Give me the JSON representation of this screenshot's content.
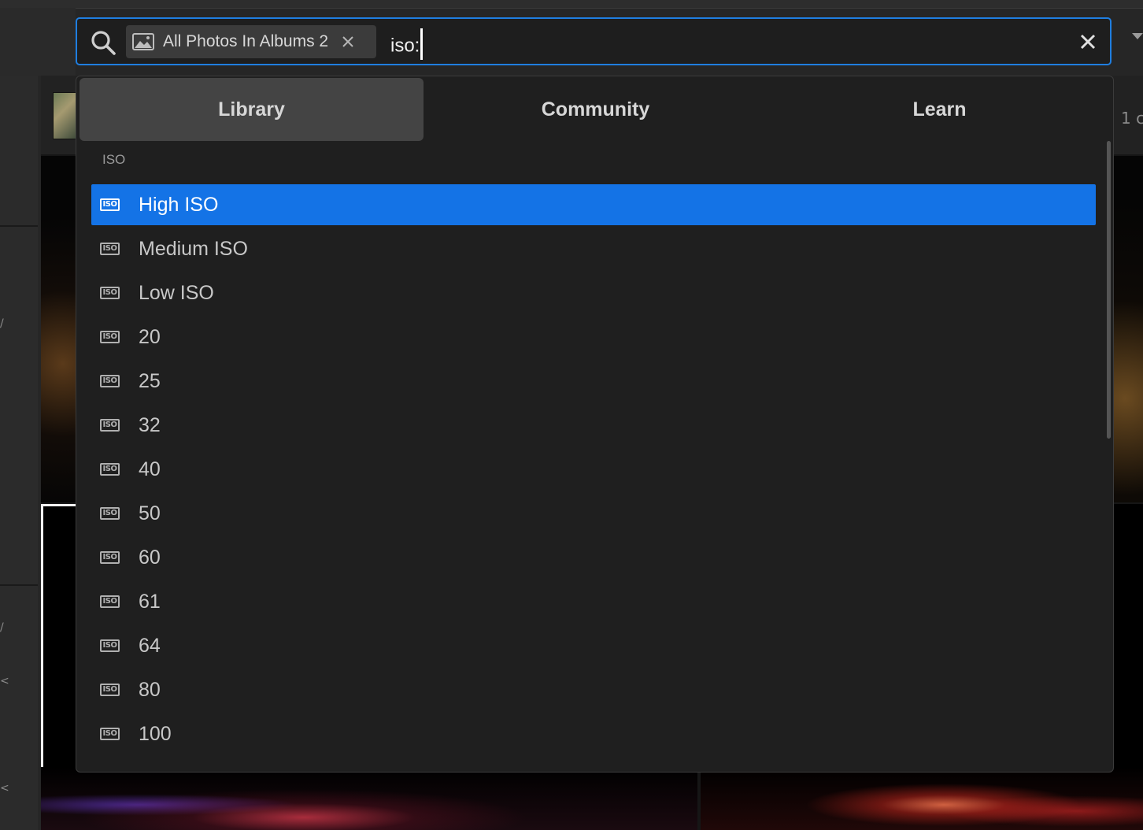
{
  "background": {
    "page_count_text": "1 c"
  },
  "search": {
    "scope_chip_label": "All Photos In Albums 2",
    "query": "iso:",
    "accent_color": "#1f7ee0"
  },
  "dropdown": {
    "tabs": [
      {
        "label": "Library",
        "active": true
      },
      {
        "label": "Community",
        "active": false
      },
      {
        "label": "Learn",
        "active": false
      }
    ],
    "section_header": "ISO",
    "icon_text": "ISO",
    "items": [
      {
        "label": "High ISO",
        "selected": true
      },
      {
        "label": "Medium ISO",
        "selected": false
      },
      {
        "label": "Low ISO",
        "selected": false
      },
      {
        "label": "20",
        "selected": false
      },
      {
        "label": "25",
        "selected": false
      },
      {
        "label": "32",
        "selected": false
      },
      {
        "label": "40",
        "selected": false
      },
      {
        "label": "50",
        "selected": false
      },
      {
        "label": "60",
        "selected": false
      },
      {
        "label": "61",
        "selected": false
      },
      {
        "label": "64",
        "selected": false
      },
      {
        "label": "80",
        "selected": false
      },
      {
        "label": "100",
        "selected": false
      }
    ],
    "selection_color": "#1473e6"
  }
}
